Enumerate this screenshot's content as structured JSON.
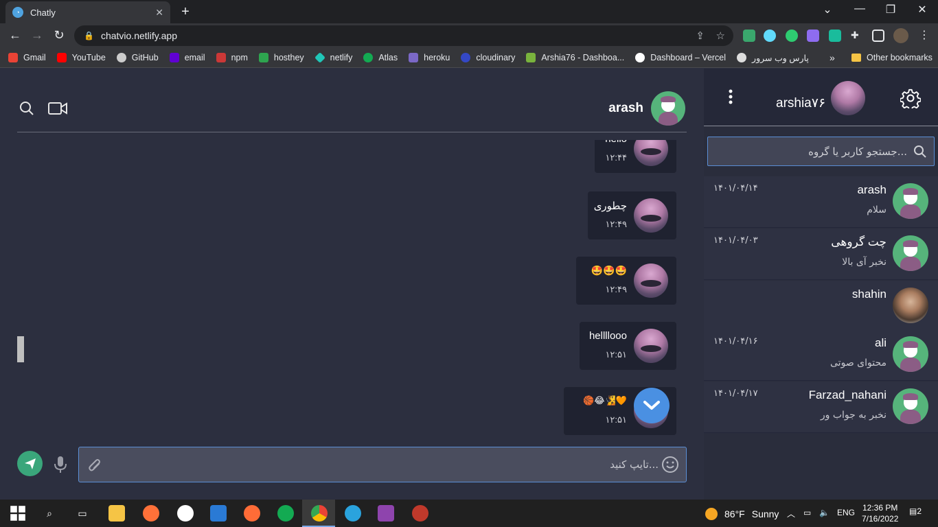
{
  "browser": {
    "tab_title": "Chatly",
    "tab_close": "✕",
    "new_tab": "+",
    "url": "chatvio.netlify.app",
    "bookmarks": [
      {
        "label": "Gmail",
        "color": "#ea4335"
      },
      {
        "label": "YouTube",
        "color": "#ff0000"
      },
      {
        "label": "GitHub",
        "color": "#cccccc"
      },
      {
        "label": "email",
        "color": "#6001d2"
      },
      {
        "label": "npm",
        "color": "#cb3837"
      },
      {
        "label": "hosthey",
        "color": "#2ea44f"
      },
      {
        "label": "netlify",
        "color": "#20c6b7"
      },
      {
        "label": "Atlas",
        "color": "#13aa52"
      },
      {
        "label": "heroku",
        "color": "#7b68c6"
      },
      {
        "label": "cloudinary",
        "color": "#3448c5"
      },
      {
        "label": "Arshia76 - Dashboa...",
        "color": "#79b33d"
      },
      {
        "label": "Dashboard – Vercel",
        "color": "#ffffff"
      },
      {
        "label": "پارس وب سرور",
        "color": "#dddddd"
      }
    ],
    "more_bookmarks": "»",
    "other_bookmarks": "Other bookmarks"
  },
  "chat": {
    "contact_name": "arash",
    "messages": [
      {
        "text": "hello",
        "time": "۱۲:۴۴"
      },
      {
        "text": "چطوری",
        "time": "۱۲:۴۹"
      },
      {
        "text": "🤩🤩🤩",
        "time": "۱۲:۴۹"
      },
      {
        "text": "hellllooo",
        "time": "۱۲:۵۱"
      },
      {
        "text": "🏀😂🧏🧡",
        "time": "۱۲:۵۱"
      }
    ],
    "composer_placeholder": "تایپ کنید..."
  },
  "sidebar": {
    "username": "arshia۷۶",
    "search_placeholder": "جستجو کاربر یا گروه...",
    "contacts": [
      {
        "name": "arash",
        "last": "سلام",
        "date": "۱۴۰۱/۰۴/۱۴"
      },
      {
        "name": "چت گروهی",
        "last": "نخبر آی بالا",
        "date": "۱۴۰۱/۰۴/۰۳"
      },
      {
        "name": "shahin",
        "last": "",
        "date": ""
      },
      {
        "name": "ali",
        "last": "محتوای صوتی",
        "date": "۱۴۰۱/۰۴/۱۶"
      },
      {
        "name": "Farzad_nahani",
        "last": "نخبر به جواب ور",
        "date": "۱۴۰۱/۰۴/۱۷"
      }
    ]
  },
  "taskbar": {
    "temperature": "86°F",
    "condition": "Sunny",
    "language": "ENG",
    "time": "12:36 PM",
    "date": "7/16/2022",
    "notifications": "2"
  }
}
